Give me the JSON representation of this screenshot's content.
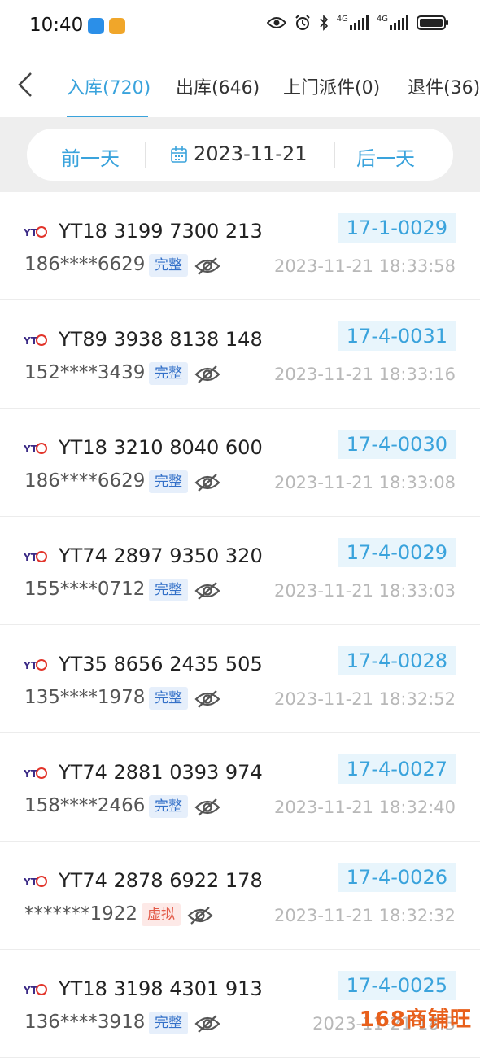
{
  "status_bar": {
    "time": "10:40",
    "network_1": "4G",
    "network_2": "4G"
  },
  "tabs": [
    {
      "label": "入库(720)",
      "active": true
    },
    {
      "label": "出库(646)",
      "active": false
    },
    {
      "label": "上门派件(0)",
      "active": false
    },
    {
      "label": "退件(36)",
      "active": false
    }
  ],
  "date_bar": {
    "prev_label": "前一天",
    "date": "2023-11-21",
    "next_label": "后一天"
  },
  "colors": {
    "accent": "#3aa3dc",
    "badge_ok": "#3370c8",
    "badge_virtual": "#e25a48"
  },
  "items": [
    {
      "tracking": "YT18 3199 7300 213",
      "shelf": "17-1-0029",
      "phone": "186****6629",
      "status": "完整",
      "time": "2023-11-21 18:33:58"
    },
    {
      "tracking": "YT89 3938 8138 148",
      "shelf": "17-4-0031",
      "phone": "152****3439",
      "status": "完整",
      "time": "2023-11-21 18:33:16"
    },
    {
      "tracking": "YT18 3210 8040 600",
      "shelf": "17-4-0030",
      "phone": "186****6629",
      "status": "完整",
      "time": "2023-11-21 18:33:08"
    },
    {
      "tracking": "YT74 2897 9350 320",
      "shelf": "17-4-0029",
      "phone": "155****0712",
      "status": "完整",
      "time": "2023-11-21 18:33:03"
    },
    {
      "tracking": "YT35 8656 2435 505",
      "shelf": "17-4-0028",
      "phone": "135****1978",
      "status": "完整",
      "time": "2023-11-21 18:32:52"
    },
    {
      "tracking": "YT74 2881 0393 974",
      "shelf": "17-4-0027",
      "phone": "158****2466",
      "status": "完整",
      "time": "2023-11-21 18:32:40"
    },
    {
      "tracking": "YT74 2878 6922 178",
      "shelf": "17-4-0026",
      "phone": "*******1922",
      "status": "虚拟",
      "time": "2023-11-21 18:32:32"
    },
    {
      "tracking": "YT18 3198 4301 913",
      "shelf": "17-4-0025",
      "phone": "136****3918",
      "status": "完整",
      "time": "2023-11-21 18:3"
    }
  ],
  "watermark": "168商铺旺"
}
